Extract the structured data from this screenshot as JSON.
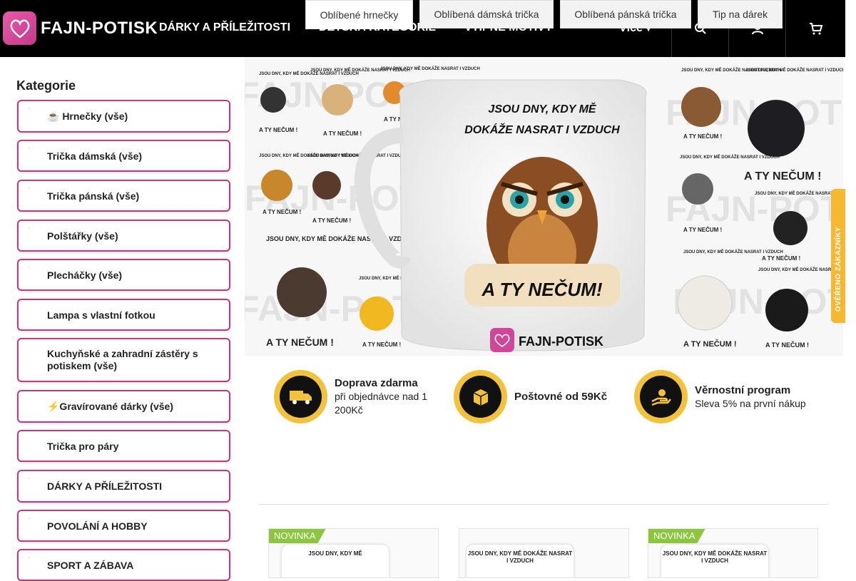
{
  "header": {
    "logo_text": "FAJN-POTISK",
    "nav": [
      "DÁRKY A PŘÍLEŽITOSTI",
      "DĚTSKÁ KATEGORIE",
      "VTIPNÉ MOTIVY"
    ],
    "more_label": "Více",
    "icons": [
      "search-icon",
      "user-icon",
      "cart-icon"
    ]
  },
  "sidebar": {
    "title": "Kategorie",
    "items": [
      {
        "label": "☕ Hrnečky (vše)"
      },
      {
        "label": " Trička dámská (vše)"
      },
      {
        "label": " Trička pánská (vše)"
      },
      {
        "label": " Polštářky (vše)"
      },
      {
        "label": " Plecháčky (vše)"
      },
      {
        "label": " Lampa s vlastní fotkou"
      },
      {
        "label": " Kuchyňské a zahradní zástěry s potiskem (vše)"
      },
      {
        "label": "⚡Gravírované dárky (vše)"
      },
      {
        "label": " Trička pro páry"
      },
      {
        "label": "DÁRKY A PŘÍLEŽITOSTI"
      },
      {
        "label": "POVOLÁNÍ A HOBBY"
      },
      {
        "label": "SPORT A ZÁBAVA"
      }
    ]
  },
  "banner": {
    "headline_line1": "JSOU DNY, KDY MĚ",
    "headline_line2": "DOKÁŽE NASRAT I VZDUCH",
    "punchline": "A TY NEČUM!",
    "watermark": "FAJN-POTISK",
    "small_text": "JSOU DNY, KDY MĚ DOKÁŽE NASRAT I VZDUCH",
    "small_punch": "A TY NEČUM !"
  },
  "review_tab": {
    "label": "OVĚŘENO ZÁKAZNÍKY"
  },
  "benefits": [
    {
      "title": "Doprava zdarma",
      "subtitle": "při objednávce nad 1 200Kč",
      "icon": "truck-icon"
    },
    {
      "title": "Poštovné od 59Kč",
      "subtitle": "",
      "icon": "package-icon"
    },
    {
      "title": "Věrnostní program",
      "subtitle": "Sleva 5% na první nákup",
      "icon": "hand-coin-icon"
    }
  ],
  "tabs": [
    "Oblíbené hrnečky",
    "Oblíbená dámská trička",
    "Oblíbená pánská trička",
    "Tip na dárek"
  ],
  "products": [
    {
      "badge": "NOVINKA",
      "mug_text": "JSOU DNY, KDY MĚ"
    },
    {
      "badge": "",
      "mug_text": "JSOU DNY, KDY MĚ DOKÁŽE NASRAT I VZDUCH"
    },
    {
      "badge": "NOVINKA",
      "mug_text": "JSOU DNY, KDY MĚ DOKÁŽE NASRAT I VZDUCH"
    }
  ],
  "colors": {
    "accent": "#c2387e",
    "gold": "#f2c23d",
    "badge_green": "#8cc63f",
    "header_bg": "#000000"
  }
}
